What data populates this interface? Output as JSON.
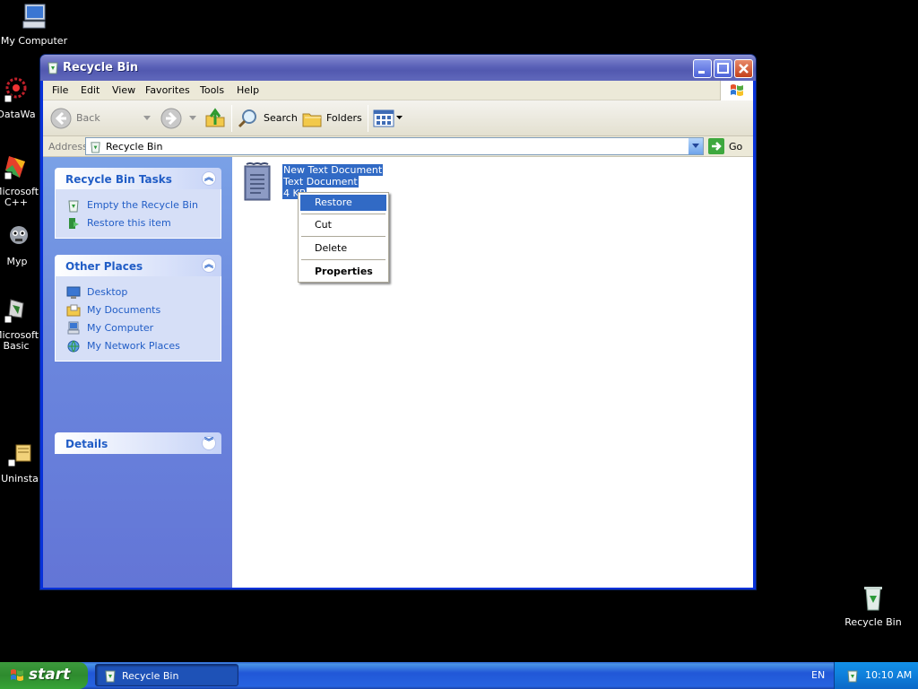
{
  "desktop": {
    "icons": [
      {
        "label": "My Computer",
        "icon": "my-computer-icon"
      },
      {
        "label": "DataWa",
        "icon": "datawa-icon"
      },
      {
        "label": "Microsoft C++",
        "icon": "visual-cpp-icon"
      },
      {
        "label": "Myp",
        "icon": "myp-icon"
      },
      {
        "label": "Microsoft Basic",
        "icon": "visual-basic-icon"
      },
      {
        "label": "Uninsta",
        "icon": "uninstall-icon"
      },
      {
        "label": "Recycle Bin",
        "icon": "recycle-bin-icon"
      }
    ]
  },
  "window": {
    "title": "Recycle Bin",
    "menu": [
      "File",
      "Edit",
      "View",
      "Favorites",
      "Tools",
      "Help"
    ],
    "toolbar": {
      "back": "Back",
      "search": "Search",
      "folders": "Folders"
    },
    "address": {
      "label": "Address",
      "value": "Recycle Bin",
      "go": "Go"
    }
  },
  "tasks": {
    "panels": [
      {
        "title": "Recycle Bin Tasks",
        "chevron": "up",
        "links": [
          {
            "label": "Empty the Recycle Bin",
            "icon": "empty-recycle-bin-icon"
          },
          {
            "label": "Restore this item",
            "icon": "restore-icon"
          }
        ]
      },
      {
        "title": "Other Places",
        "chevron": "up",
        "links": [
          {
            "label": "Desktop",
            "icon": "desktop-icon"
          },
          {
            "label": "My Documents",
            "icon": "my-documents-icon"
          },
          {
            "label": "My Computer",
            "icon": "my-computer-icon"
          },
          {
            "label": "My Network Places",
            "icon": "network-places-icon"
          }
        ]
      },
      {
        "title": "Details",
        "chevron": "down",
        "links": []
      }
    ]
  },
  "file": {
    "name": "New Text Document",
    "type": "Text Document",
    "size": "4 KB"
  },
  "context_menu": {
    "items": [
      "Restore",
      "Cut",
      "Delete",
      "Properties"
    ],
    "selected": "Restore"
  },
  "taskbar": {
    "start": "start",
    "task": "Recycle Bin",
    "lang": "EN",
    "clock": "10:10 AM"
  }
}
